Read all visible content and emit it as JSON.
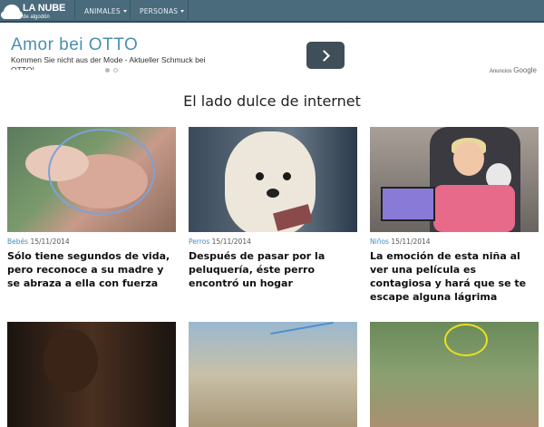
{
  "header": {
    "logo_title": "LA NUBE",
    "logo_subtitle": "de algodón",
    "nav": [
      {
        "label": "ANIMALES"
      },
      {
        "label": "PERSONAS"
      }
    ]
  },
  "ad": {
    "title": "Amor bei OTTO",
    "text": "Kommen Sie nicht aus der Mode - Aktueller Schmuck bei OTTO!",
    "adchoices_prefix": "Anuncios",
    "adchoices_brand": "Google"
  },
  "section_title": "El lado dulce de internet",
  "cards": [
    {
      "category": "Bebés",
      "date": "15/11/2014",
      "headline": "Sólo tiene segundos de vida, pero reconoce a su madre y se abraza a ella con fuerza"
    },
    {
      "category": "Perros",
      "date": "15/11/2014",
      "headline": "Después de pasar por la peluquería, éste perro encontró un hogar"
    },
    {
      "category": "Niños",
      "date": "15/11/2014",
      "headline": "La emoción de esta niña al ver una película es contagiosa y hará que se te escape alguna lágrima"
    }
  ],
  "colors": {
    "nav_bg": "#4a6b7c",
    "category_link": "#3f8fc0",
    "ad_title": "#4a90b0"
  }
}
